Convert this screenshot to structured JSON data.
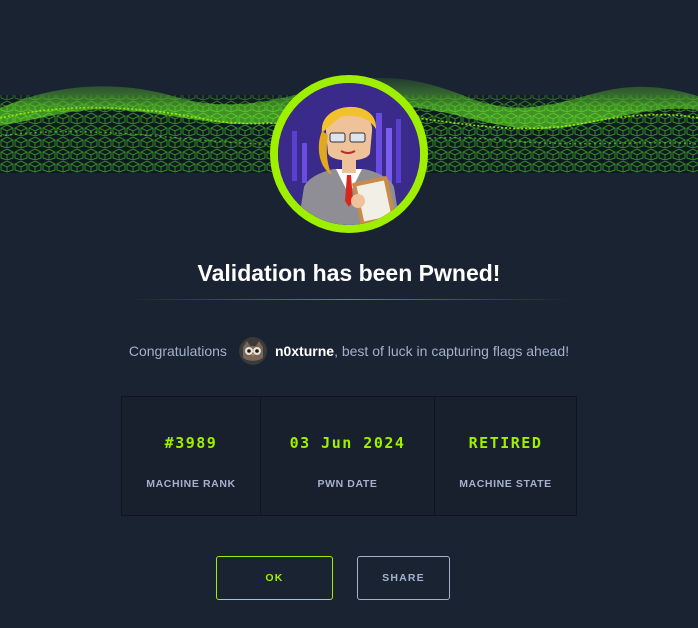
{
  "dialog": {
    "title": "Validation has been Pwned!",
    "congrats_prefix": "Congratulations",
    "username": "n0xturne",
    "congrats_suffix": ", best of luck in capturing flags ahead!"
  },
  "stats": [
    {
      "value": "#3989",
      "label": "MACHINE RANK"
    },
    {
      "value": "03 Jun 2024",
      "label": "PWN DATE"
    },
    {
      "value": "RETIRED",
      "label": "MACHINE STATE"
    }
  ],
  "buttons": {
    "ok": "OK",
    "share": "SHARE"
  },
  "icons": {
    "machine_avatar": "businesswoman-avatar-icon",
    "user_avatar": "owl-avatar-icon"
  },
  "colors": {
    "background": "#1a2332",
    "accent": "#9fef00",
    "text": "#a4b1cd",
    "white": "#ffffff"
  }
}
